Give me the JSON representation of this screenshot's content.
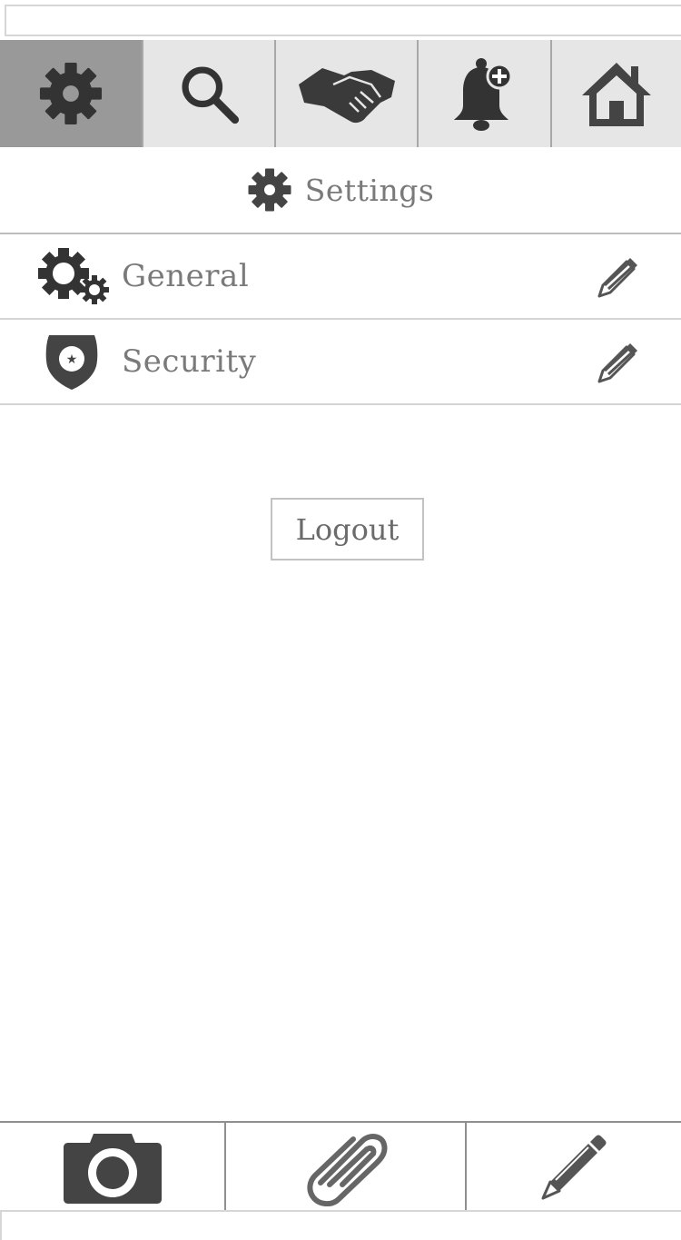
{
  "top_bar": {},
  "tabbar": {
    "tabs": [
      {
        "icon": "gear-icon",
        "active": true
      },
      {
        "icon": "search-icon",
        "active": false
      },
      {
        "icon": "handshake-icon",
        "active": false
      },
      {
        "icon": "bell-add-icon",
        "active": false
      },
      {
        "icon": "home-icon",
        "active": false
      }
    ]
  },
  "header": {
    "icon": "gear-icon",
    "title": "Settings"
  },
  "settings_list": [
    {
      "icon": "gears-icon",
      "label": "General",
      "action_icon": "pencil-icon"
    },
    {
      "icon": "badge-icon",
      "label": "Security",
      "action_icon": "pencil-icon"
    }
  ],
  "logout": {
    "label": "Logout"
  },
  "bottom_bar": {
    "buttons": [
      {
        "icon": "camera-icon"
      },
      {
        "icon": "paperclip-icon"
      },
      {
        "icon": "pencil-icon"
      }
    ]
  },
  "colors": {
    "tabbar_bg": "#e6e6e6",
    "tab_active_bg": "#999999",
    "icon_dark": "#333333",
    "icon_mid": "#555555",
    "text": "#7a7a7a"
  }
}
